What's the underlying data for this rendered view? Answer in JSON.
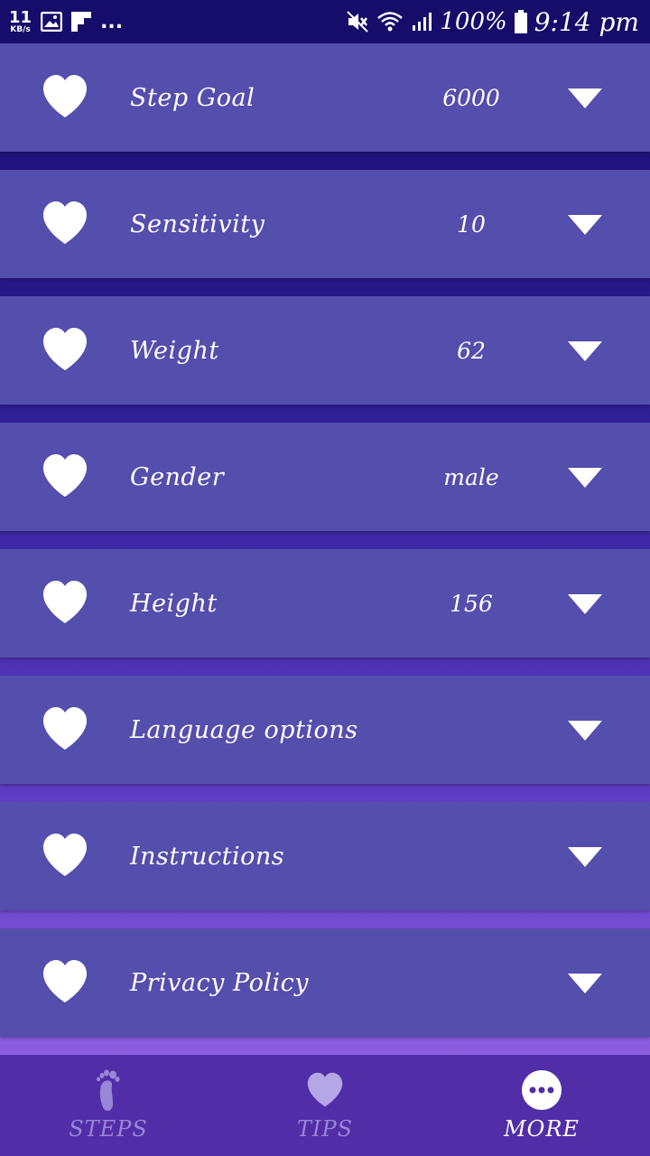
{
  "status_bar": {
    "speed_value": "11",
    "speed_unit": "KB/s",
    "overflow": "...",
    "battery_percent": "100%",
    "time": "9:14 pm",
    "icons": [
      "gallery-icon",
      "flipboard-icon",
      "mute-icon",
      "wifi-icon",
      "signal-icon",
      "battery-icon"
    ]
  },
  "settings": {
    "items": [
      {
        "label": "Step Goal",
        "value": "6000",
        "icon": "heart-icon"
      },
      {
        "label": "Sensitivity",
        "value": "10",
        "icon": "heart-icon"
      },
      {
        "label": "Weight",
        "value": "62",
        "icon": "heart-icon"
      },
      {
        "label": "Gender",
        "value": "male",
        "icon": "heart-icon"
      },
      {
        "label": "Height",
        "value": "156",
        "icon": "heart-icon"
      },
      {
        "label": "Language options",
        "value": "",
        "icon": "heart-icon"
      },
      {
        "label": "Instructions",
        "value": "",
        "icon": "heart-icon"
      },
      {
        "label": "Privacy Policy",
        "value": "",
        "icon": "heart-icon"
      }
    ]
  },
  "bottom_nav": {
    "items": [
      {
        "label": "STEPS",
        "icon": "footprint-icon",
        "active": false
      },
      {
        "label": "TIPS",
        "icon": "heart-icon",
        "active": false
      },
      {
        "label": "MORE",
        "icon": "more-icon",
        "active": true
      }
    ]
  },
  "colors": {
    "status_bar": "#160d6a",
    "row_background": "#544ead",
    "nav_background": "#512ea8",
    "nav_inactive": "#9a86d6",
    "text": "#ffffff"
  }
}
